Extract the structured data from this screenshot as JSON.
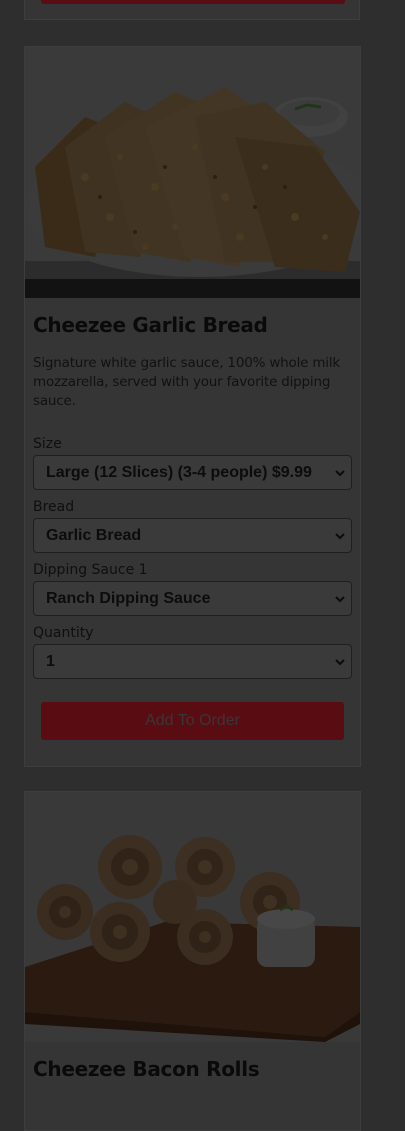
{
  "items": [
    {
      "title": "Cheezee Garlic Bread",
      "description": "Signature white garlic sauce, 100% whole milk mozzarella, served with your favorite dipping sauce.",
      "options": [
        {
          "label": "Size",
          "value": "Large (12 Slices) (3-4 people) $9.99"
        },
        {
          "label": "Bread",
          "value": "Garlic Bread"
        },
        {
          "label": "Dipping Sauce 1",
          "value": "Ranch Dipping Sauce"
        },
        {
          "label": "Quantity",
          "value": "1"
        }
      ],
      "button_label": "Add To Order",
      "image_icon": "garlic-bread-photo"
    },
    {
      "title": "Cheezee Bacon Rolls",
      "image_icon": "bacon-rolls-photo"
    }
  ],
  "colors": {
    "overlay_background": "#2e2e2e",
    "card_background": "#353535",
    "button": "#5a0c13"
  }
}
